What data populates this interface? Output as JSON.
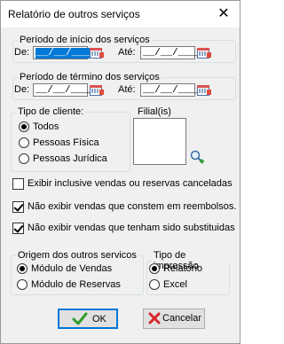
{
  "window": {
    "title": "Relatório de outros serviços",
    "close_glyph": "✕"
  },
  "periodo_inicio": {
    "legend": "Período de início dos serviços",
    "de_label": "De:",
    "ate_label": "Até:",
    "de_value": "__/__/____",
    "ate_value": "__/__/____"
  },
  "periodo_termino": {
    "legend": "Período de término dos serviços",
    "de_label": "De:",
    "ate_label": "Até:",
    "de_value": "__/__/____",
    "ate_value": "__/__/____"
  },
  "tipo_cliente": {
    "legend": "Tipo de cliente:",
    "options": [
      "Todos",
      "Pessoas Física",
      "Pessoas Jurídica"
    ],
    "selected": "Todos"
  },
  "filiais": {
    "label": "Filial(is)"
  },
  "checkboxes": [
    {
      "label": "Exibir inclusive vendas ou reservas canceladas",
      "checked": false
    },
    {
      "label": "Não exibir vendas que constem em reembolsos.",
      "checked": true
    },
    {
      "label": "Não exibir vendas que tenham sido substituidas",
      "checked": true
    }
  ],
  "origem": {
    "legend": "Origem dos outros servicos",
    "options": [
      "Módulo de Vendas",
      "Módulo de Reservas"
    ],
    "selected": "Módulo de Vendas"
  },
  "tipo_impressao": {
    "legend": "Tipo de impressão",
    "options": [
      "Relatório",
      "Excel"
    ],
    "selected": "Relatório"
  },
  "buttons": {
    "ok": "OK",
    "cancel": "Cancelar"
  },
  "colors": {
    "accent": "#0078d7",
    "ok_check": "#2e9e2e",
    "cancel_x": "#d9262b"
  }
}
